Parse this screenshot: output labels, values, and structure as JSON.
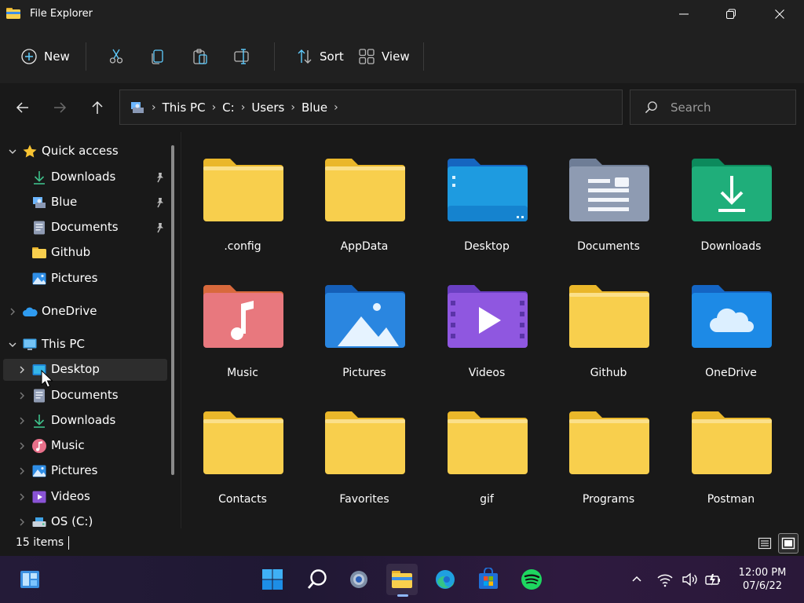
{
  "window": {
    "title": "File Explorer"
  },
  "toolbar": {
    "new_label": "New",
    "sort_label": "Sort",
    "view_label": "View"
  },
  "address": {
    "crumbs": [
      "This PC",
      "C:",
      "Users",
      "Blue"
    ]
  },
  "search": {
    "placeholder": "Search"
  },
  "sidebar": {
    "quick_access": {
      "label": "Quick access",
      "items": [
        {
          "label": "Downloads",
          "pinned": true
        },
        {
          "label": "Blue",
          "pinned": true
        },
        {
          "label": "Documents",
          "pinned": true
        },
        {
          "label": "Github",
          "pinned": false
        },
        {
          "label": "Pictures",
          "pinned": false
        }
      ]
    },
    "onedrive": {
      "label": "OneDrive"
    },
    "this_pc": {
      "label": "This PC",
      "items": [
        {
          "label": "Desktop",
          "selected": true
        },
        {
          "label": "Documents"
        },
        {
          "label": "Downloads"
        },
        {
          "label": "Music"
        },
        {
          "label": "Pictures"
        },
        {
          "label": "Videos"
        },
        {
          "label": "OS (C:)"
        }
      ]
    }
  },
  "content": {
    "items": [
      {
        "name": ".config",
        "type": "folder-yellow"
      },
      {
        "name": "AppData",
        "type": "folder-yellow"
      },
      {
        "name": "Desktop",
        "type": "folder-desktop"
      },
      {
        "name": "Documents",
        "type": "folder-documents"
      },
      {
        "name": "Downloads",
        "type": "folder-downloads"
      },
      {
        "name": "Music",
        "type": "folder-music"
      },
      {
        "name": "Pictures",
        "type": "folder-pictures"
      },
      {
        "name": "Videos",
        "type": "folder-videos"
      },
      {
        "name": "Github",
        "type": "folder-yellow"
      },
      {
        "name": "OneDrive",
        "type": "folder-onedrive"
      },
      {
        "name": "Contacts",
        "type": "folder-yellow"
      },
      {
        "name": "Favorites",
        "type": "folder-yellow"
      },
      {
        "name": "gif",
        "type": "folder-yellow"
      },
      {
        "name": "Programs",
        "type": "folder-yellow"
      },
      {
        "name": "Postman",
        "type": "folder-yellow"
      }
    ]
  },
  "status": {
    "item_count": "15 items"
  },
  "taskbar": {
    "clock_time": "12:00 PM",
    "clock_date": "07/6/22",
    "apps": [
      "start-icon",
      "search-icon",
      "settings-icon",
      "file-explorer-icon",
      "edge-icon",
      "store-icon",
      "spotify-icon"
    ]
  },
  "colors": {
    "folder_yellow": "#f8cf4d",
    "folder_yellow_back": "#eab72a",
    "accent": "#60cdff",
    "selected_bg": "#2d2d2d"
  }
}
